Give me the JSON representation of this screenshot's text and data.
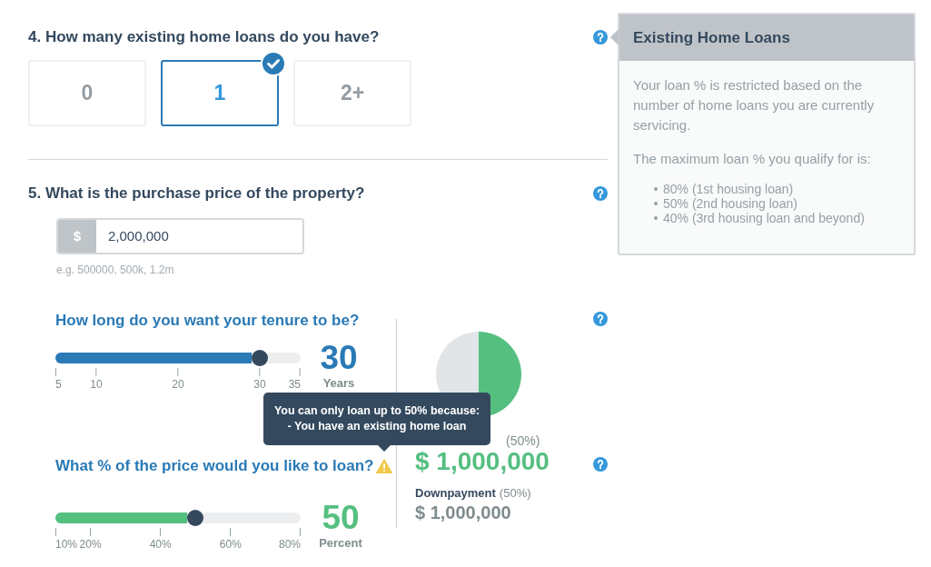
{
  "questions": [
    {
      "kind": "choice",
      "title": "4. How many existing home loans do you have?",
      "options": [
        {
          "label": "0",
          "selected": false
        },
        {
          "label": "1",
          "selected": true
        },
        {
          "label": "2+",
          "selected": false
        }
      ]
    },
    {
      "kind": "price",
      "title": "5. What is the purchase price of the property?",
      "currency": "$",
      "value": "2,000,000",
      "hint": "e.g. 500000, 500k, 1.2m"
    }
  ],
  "tenure": {
    "label": "How long do you want your tenure to be?",
    "level": 0.833,
    "ticks": [
      "5",
      "10",
      "20",
      "30",
      "35"
    ],
    "value": "30",
    "unit": "Years"
  },
  "loan_percent": {
    "label": "What % of the price would you like to loan?",
    "warning": true,
    "level": 0.571,
    "ticks": [
      "10%",
      "20%",
      "40%",
      "60%",
      "80%"
    ],
    "value": "50",
    "unit": "Percent"
  },
  "summary": {
    "chart_data": {
      "type": "pie",
      "values": [
        50,
        50
      ]
    },
    "loan_share": "(50%)",
    "loan_amount": "$ 1,000,000",
    "downpayment_label": "Downpayment",
    "downpayment_share": "(50%)",
    "downpayment_amount": "$ 1,000,000"
  },
  "tooltip": {
    "lines": [
      "You can only loan up to 50% because:",
      "- You have an existing home loan"
    ]
  },
  "info_panel": {
    "title": "Existing Home Loans",
    "paragraphs": [
      "Your loan % is restricted based on the number of home loans you are currently servicing.",
      "The maximum loan % you qualify for is:"
    ],
    "bullets": [
      "80% (1st housing loan)",
      "50% (2nd housing loan)",
      "40% (3rd housing loan and beyond)"
    ]
  }
}
